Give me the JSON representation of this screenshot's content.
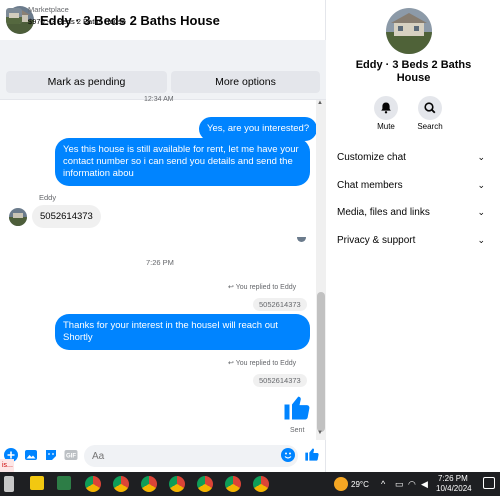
{
  "header": {
    "title": "Eddy · 3 Beds 2 Baths House"
  },
  "marketplace": {
    "label": "Marketplace",
    "listing": "$970 - 3 Beds 2 Baths House",
    "mark_pending": "Mark as pending",
    "more_options": "More options"
  },
  "messages": {
    "cut_timestamp": "12:34 AM",
    "m1": "Yes, are you interested?",
    "m2": "Yes this house is still available for rent, let me have your contact number so i can send you details and send the information abou",
    "sender": "Eddy",
    "m3": "5052614373",
    "time_divider": "7:26 PM",
    "replied1": "You replied to Eddy",
    "quote1": "5052614373",
    "m4": "Thanks for your interest in the houseI will reach out Shortly",
    "replied2": "You replied to Eddy",
    "quote2": "5052614373",
    "status": "Sent"
  },
  "composer": {
    "placeholder": "Aa"
  },
  "info": {
    "title": "Eddy · 3 Beds 2 Baths House",
    "mute": "Mute",
    "search": "Search",
    "sections": [
      "Customize chat",
      "Chat members",
      "Media, files and links",
      "Privacy & support"
    ]
  },
  "taskbar": {
    "temperature": "29°C",
    "time": "7:26 PM",
    "date": "10/4/2024",
    "left_strip": "is..."
  },
  "colors": {
    "accent": "#0084ff",
    "bubble_in": "#f0f0f0",
    "taskbar": "#1e1f22"
  }
}
